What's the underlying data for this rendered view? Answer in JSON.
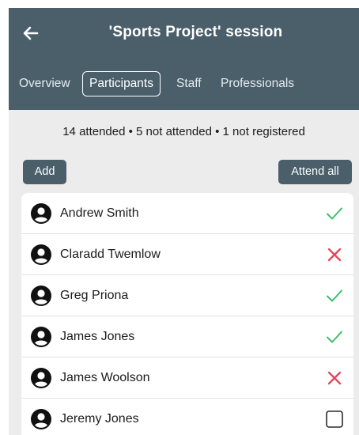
{
  "header": {
    "back_icon": "arrow-left-icon",
    "title": "'Sports Project' session",
    "background": "#4b5f6b"
  },
  "tabs": [
    {
      "label": "Overview",
      "active": false
    },
    {
      "label": "Participants",
      "active": true
    },
    {
      "label": "Staff",
      "active": false
    },
    {
      "label": "Professionals",
      "active": false
    }
  ],
  "summary": "14 attended • 5 not attended • 1 not registered",
  "actions": {
    "add_label": "Add",
    "attend_all_label": "Attend all"
  },
  "participants": [
    {
      "name": "Andrew Smith",
      "status": "attended"
    },
    {
      "name": "Claradd Twemlow",
      "status": "not-attended"
    },
    {
      "name": "Greg Priona",
      "status": "attended"
    },
    {
      "name": "James Jones",
      "status": "attended"
    },
    {
      "name": "James Woolson",
      "status": "not-attended"
    },
    {
      "name": "Jeremy Jones",
      "status": "not-registered"
    }
  ],
  "colors": {
    "attended": "#3cc06a",
    "not_attended": "#e5485a",
    "not_registered": "#2b2b2b"
  }
}
